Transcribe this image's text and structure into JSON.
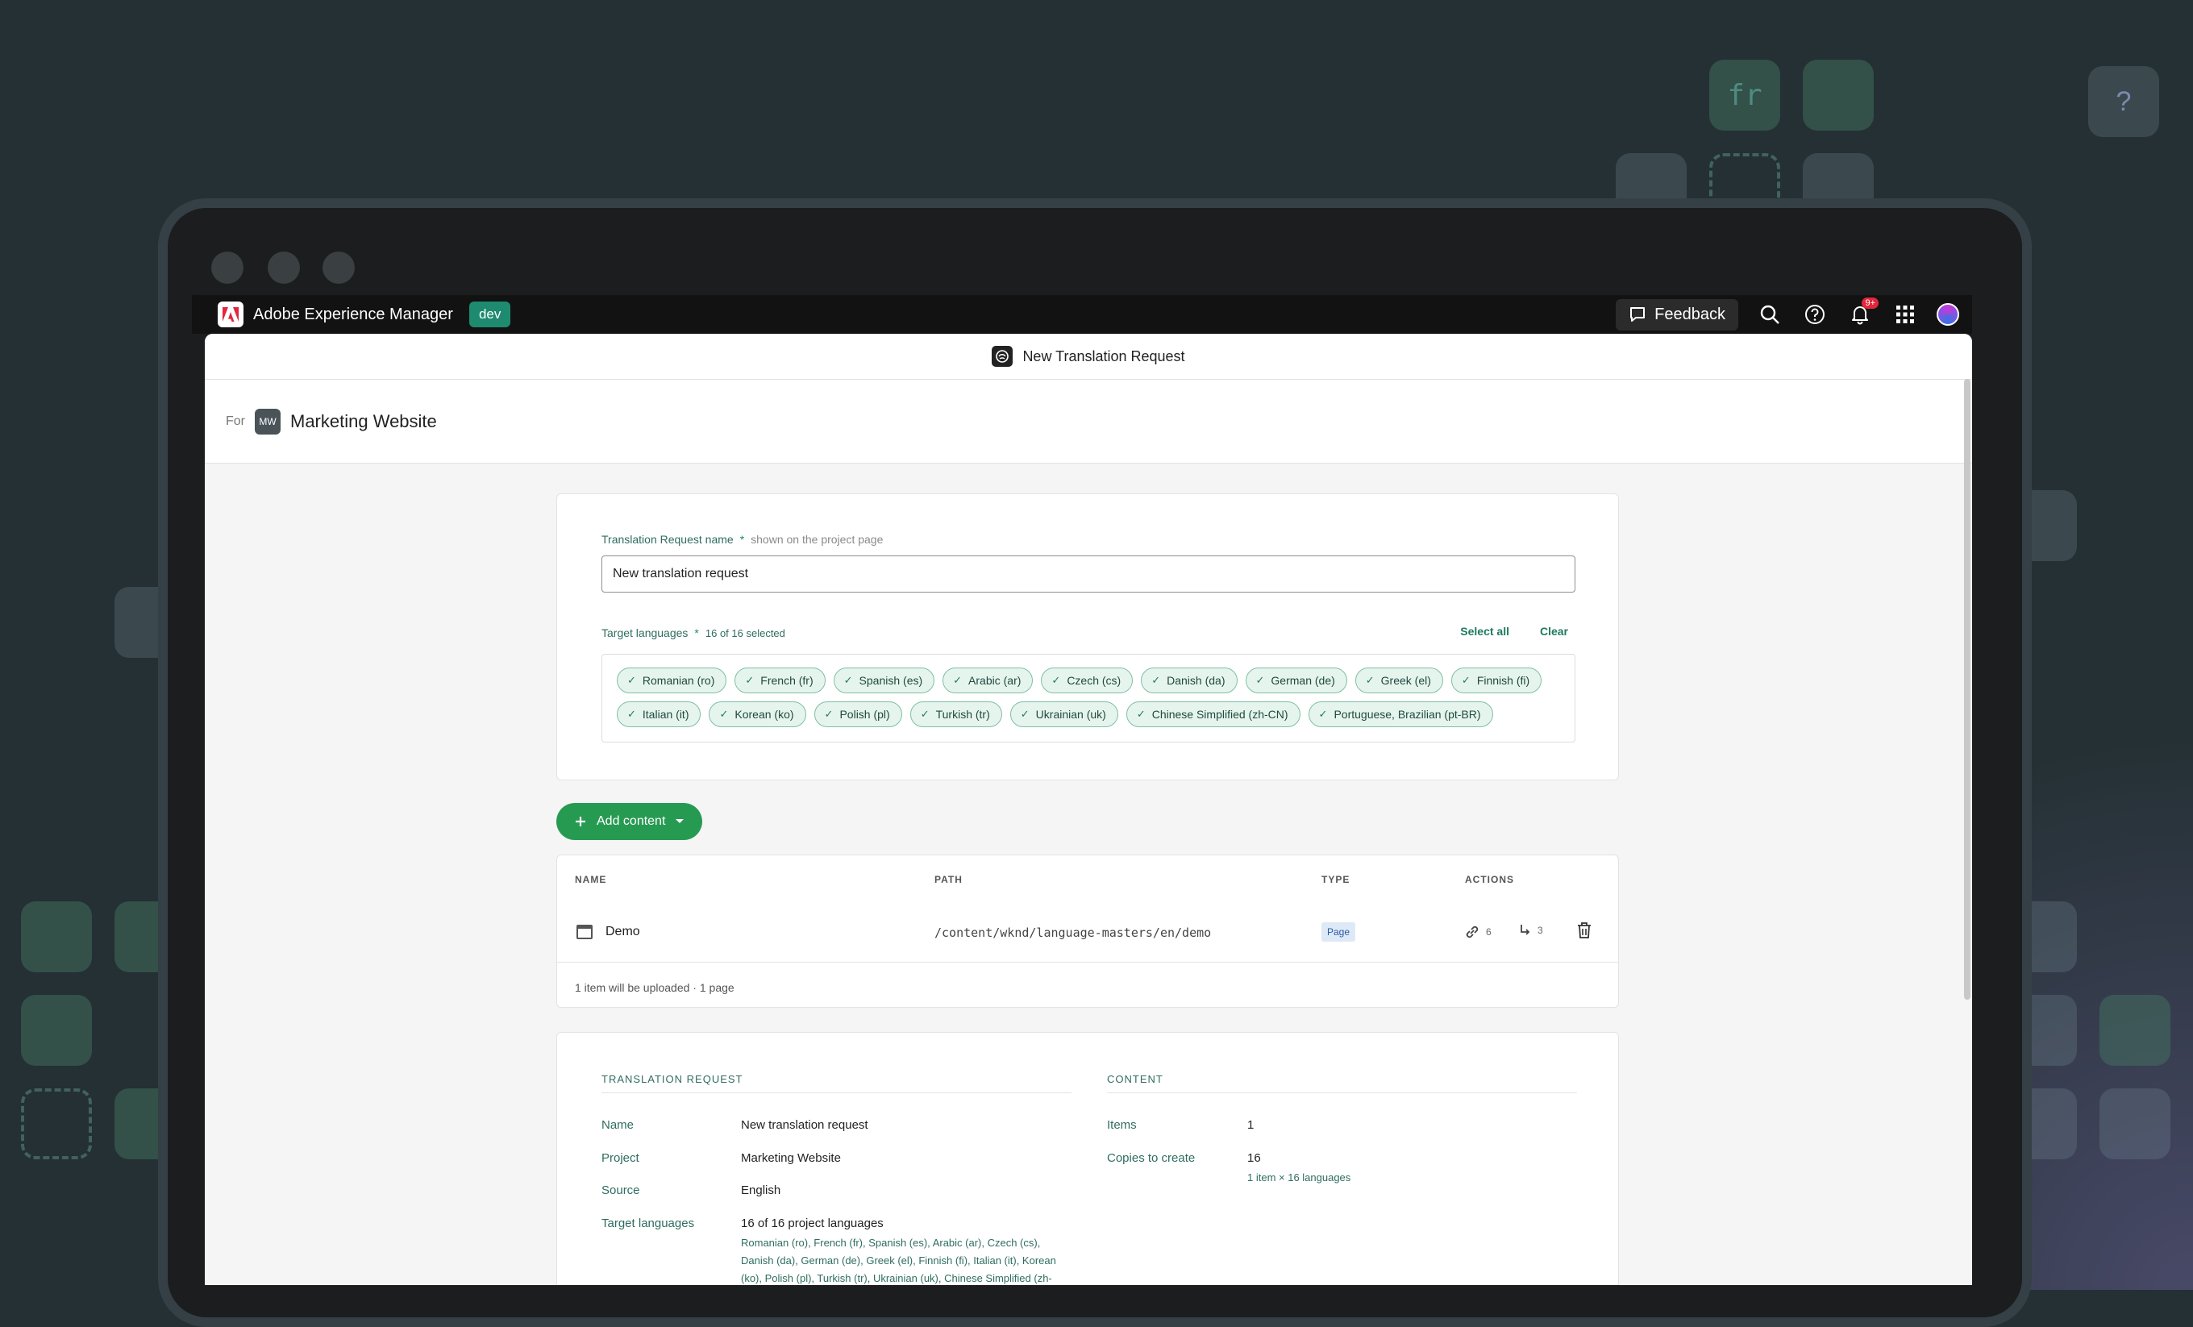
{
  "background": {
    "code_tile": "fr",
    "help_tile": "?"
  },
  "app": {
    "name": "Adobe Experience Manager",
    "env": "dev"
  },
  "topbar": {
    "feedback_label": "Feedback",
    "notification_count": "9+"
  },
  "dialog": {
    "title": "New Translation Request"
  },
  "project": {
    "for_label": "For",
    "badge": "MW",
    "name": "Marketing Website"
  },
  "form": {
    "name_label": "Translation Request name",
    "required_mark": "*",
    "name_hint": "shown on the project page",
    "name_value": "New translation request",
    "languages_label": "Target languages",
    "languages_count": "16 of 16 selected",
    "select_all": "Select all",
    "clear": "Clear",
    "languages": [
      "Romanian (ro)",
      "French (fr)",
      "Spanish (es)",
      "Arabic (ar)",
      "Czech (cs)",
      "Danish (da)",
      "German (de)",
      "Greek (el)",
      "Finnish (fi)",
      "Italian (it)",
      "Korean (ko)",
      "Polish (pl)",
      "Turkish (tr)",
      "Ukrainian (uk)",
      "Chinese Simplified (zh-CN)",
      "Portuguese, Brazilian (pt-BR)"
    ]
  },
  "add_content": {
    "label": "Add content"
  },
  "table": {
    "headers": {
      "name": "NAME",
      "path": "PATH",
      "type": "TYPE",
      "actions": "ACTIONS"
    },
    "rows": [
      {
        "name": "Demo",
        "path": "/content/wknd/language-masters/en/demo",
        "type": "Page",
        "references": "6",
        "children": "3"
      }
    ],
    "footer": "1 item will be uploaded · 1 page"
  },
  "summary": {
    "request_heading": "TRANSLATION REQUEST",
    "content_heading": "CONTENT",
    "name_label": "Name",
    "name_value": "New translation request",
    "project_label": "Project",
    "project_value": "Marketing Website",
    "source_label": "Source",
    "source_value": "English",
    "targets_label": "Target languages",
    "targets_value": "16 of 16 project languages",
    "targets_list": "Romanian (ro), French (fr), Spanish (es), Arabic (ar), Czech (cs), Danish (da), German (de), Greek (el), Finnish (fi), Italian (it), Korean (ko), Polish (pl), Turkish (tr), Ukrainian (uk), Chinese Simplified (zh-",
    "items_label": "Items",
    "items_value": "1",
    "copies_label": "Copies to create",
    "copies_value": "16",
    "copies_detail": "1 item × 16 languages"
  }
}
